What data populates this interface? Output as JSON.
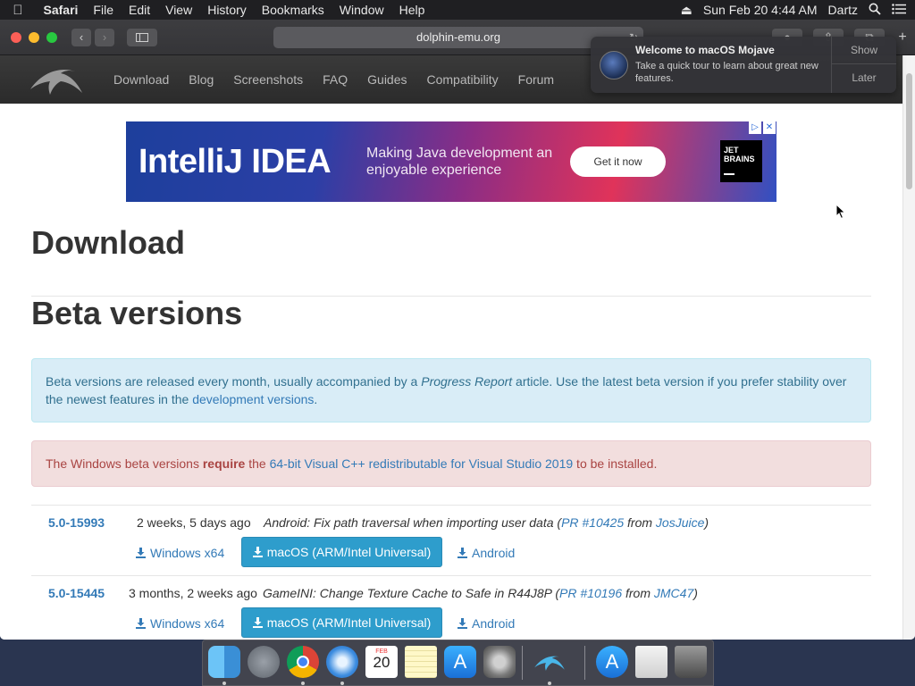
{
  "menubar": {
    "app": "Safari",
    "items": [
      "File",
      "Edit",
      "View",
      "History",
      "Bookmarks",
      "Window",
      "Help"
    ],
    "datetime": "Sun Feb 20  4:44 AM",
    "user": "Dartz"
  },
  "browser": {
    "url": "dolphin-emu.org"
  },
  "site_nav": {
    "links": [
      "Download",
      "Blog",
      "Screenshots",
      "FAQ",
      "Guides",
      "Compatibility",
      "Forum"
    ]
  },
  "ad": {
    "title": "IntelliJ IDEA",
    "tagline": "Making Java development an enjoyable experience",
    "button": "Get it now",
    "brand_line1": "JET",
    "brand_line2": "BRAINS"
  },
  "page": {
    "heading": "Download",
    "section": "Beta versions",
    "info_text_1": "Beta versions are released every month, usually accompanied by a ",
    "info_em": "Progress Report",
    "info_text_2": " article. Use the latest beta version if you prefer stability over the newest features in the ",
    "info_link": "development versions",
    "info_text_3": ".",
    "danger_text_1": "The Windows beta versions ",
    "danger_strong": "require",
    "danger_text_2": " the ",
    "danger_link": "64-bit Visual C++ redistributable for Visual Studio 2019",
    "danger_text_3": " to be installed."
  },
  "builds": [
    {
      "version": "5.0-15993",
      "age": "2 weeks, 5 days ago",
      "message": "Android: Fix path traversal when importing user data",
      "pr": "PR #10425",
      "from": "from",
      "author": "JosJuice",
      "windows": "Windows x64",
      "macos": "macOS (ARM/Intel Universal)",
      "android": "Android"
    },
    {
      "version": "5.0-15445",
      "age": "3 months, 2 weeks ago",
      "message": "GameINI: Change Texture Cache to Safe in R44J8P",
      "pr": "PR #10196",
      "from": "from",
      "author": "JMC47",
      "windows": "Windows x64",
      "macos": "macOS (ARM/Intel Universal)",
      "android": "Android"
    }
  ],
  "notification": {
    "title": "Welcome to macOS Mojave",
    "body": "Take a quick tour to learn about great new features.",
    "show": "Show",
    "later": "Later"
  },
  "dock": {
    "calendar_month": "FEB",
    "calendar_day": "20"
  }
}
